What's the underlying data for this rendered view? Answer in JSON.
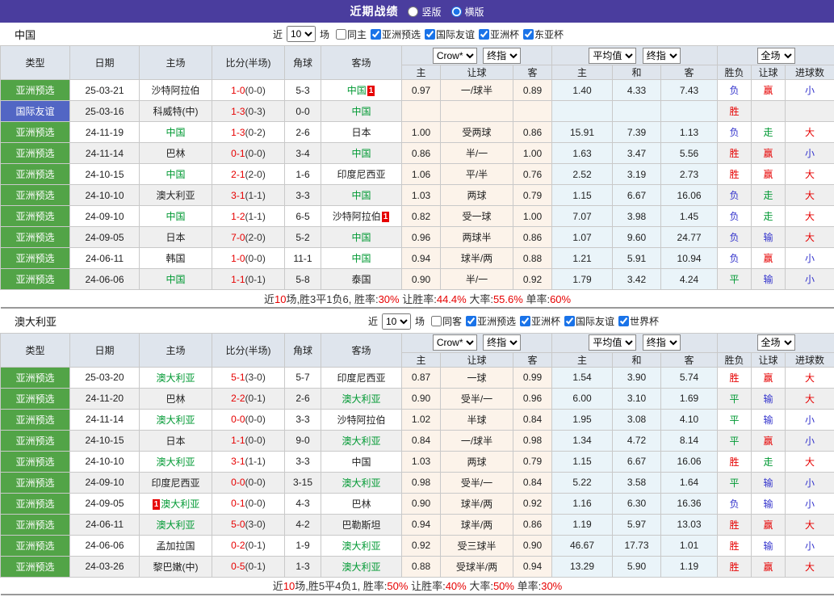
{
  "colors": {
    "purple_bar": "#4a3d9e",
    "type_green": "#52a447",
    "type_blue": "#5266c4",
    "focus_team_green": "#009933",
    "red": "#e60000",
    "green": "#009933",
    "blue": "#3333cc",
    "company_odds_bg": "#fcf3ea",
    "average_odds_bg": "#eaf4f9",
    "header_bg": "#dfe5ed",
    "row_alt_bg": "#efefef",
    "accent_blue": "#1a73e8"
  },
  "topbar": {
    "title": "近期战绩",
    "radios": [
      {
        "label": "竖版",
        "checked": false
      },
      {
        "label": "横版",
        "checked": true
      }
    ]
  },
  "columns": {
    "type": "类型",
    "date": "日期",
    "home": "主场",
    "score": "比分(半场)",
    "corner": "角球",
    "away": "客场",
    "odds_home": "主",
    "handicap": "让球",
    "odds_away": "客",
    "avg_home": "主",
    "avg_draw": "和",
    "avg_away": "客",
    "result": "胜负",
    "handicap_result": "让球",
    "goals": "进球数"
  },
  "selects": {
    "company": "Crow*",
    "company_mode": "终指",
    "average": "平均值",
    "average_mode": "终指",
    "scope": "全场"
  },
  "result_color_map": {
    "胜": "red",
    "平": "green",
    "负": "blue",
    "赢": "red",
    "走": "green",
    "输": "blue",
    "大": "red",
    "小": "blue"
  },
  "sections": [
    {
      "team": "中国",
      "filter": {
        "near_label": "近",
        "count": "10",
        "games_label": "场",
        "checkboxes": [
          {
            "label": "同主",
            "checked": false
          },
          {
            "label": "亚洲预选",
            "checked": true
          },
          {
            "label": "国际友谊",
            "checked": true
          },
          {
            "label": "亚洲杯",
            "checked": true
          },
          {
            "label": "东亚杯",
            "checked": true
          }
        ]
      },
      "rows": [
        {
          "type": "亚洲预选",
          "type_style": "green",
          "date": "25-03-21",
          "home": "沙特阿拉伯",
          "home_focus": false,
          "home_badge": "",
          "badge_before": false,
          "score_ft": "1-0",
          "score_ht": "0-0",
          "corner": "5-3",
          "away": "中国",
          "away_focus": true,
          "away_badge": "1",
          "odds": [
            "0.97",
            "一/球半",
            "0.89"
          ],
          "avg": [
            "1.40",
            "4.33",
            "7.43"
          ],
          "result": "负",
          "handicap_result": "赢",
          "goals": "小"
        },
        {
          "type": "国际友谊",
          "type_style": "blue",
          "date": "25-03-16",
          "home": "科威特(中)",
          "home_focus": false,
          "home_badge": "",
          "badge_before": false,
          "score_ft": "1-3",
          "score_ht": "0-3",
          "corner": "0-0",
          "away": "中国",
          "away_focus": true,
          "away_badge": "",
          "odds": [
            "",
            "",
            ""
          ],
          "avg": [
            "",
            "",
            ""
          ],
          "result": "胜",
          "handicap_result": "",
          "goals": ""
        },
        {
          "type": "亚洲预选",
          "type_style": "green",
          "date": "24-11-19",
          "home": "中国",
          "home_focus": true,
          "home_badge": "",
          "badge_before": false,
          "score_ft": "1-3",
          "score_ht": "0-2",
          "corner": "2-6",
          "away": "日本",
          "away_focus": false,
          "away_badge": "",
          "odds": [
            "1.00",
            "受两球",
            "0.86"
          ],
          "avg": [
            "15.91",
            "7.39",
            "1.13"
          ],
          "result": "负",
          "handicap_result": "走",
          "goals": "大"
        },
        {
          "type": "亚洲预选",
          "type_style": "green",
          "date": "24-11-14",
          "home": "巴林",
          "home_focus": false,
          "home_badge": "",
          "badge_before": false,
          "score_ft": "0-1",
          "score_ht": "0-0",
          "corner": "3-4",
          "away": "中国",
          "away_focus": true,
          "away_badge": "",
          "odds": [
            "0.86",
            "半/一",
            "1.00"
          ],
          "avg": [
            "1.63",
            "3.47",
            "5.56"
          ],
          "result": "胜",
          "handicap_result": "赢",
          "goals": "小"
        },
        {
          "type": "亚洲预选",
          "type_style": "green",
          "date": "24-10-15",
          "home": "中国",
          "home_focus": true,
          "home_badge": "",
          "badge_before": false,
          "score_ft": "2-1",
          "score_ht": "2-0",
          "corner": "1-6",
          "away": "印度尼西亚",
          "away_focus": false,
          "away_badge": "",
          "odds": [
            "1.06",
            "平/半",
            "0.76"
          ],
          "avg": [
            "2.52",
            "3.19",
            "2.73"
          ],
          "result": "胜",
          "handicap_result": "赢",
          "goals": "大"
        },
        {
          "type": "亚洲预选",
          "type_style": "green",
          "date": "24-10-10",
          "home": "澳大利亚",
          "home_focus": false,
          "home_badge": "",
          "badge_before": false,
          "score_ft": "3-1",
          "score_ht": "1-1",
          "corner": "3-3",
          "away": "中国",
          "away_focus": true,
          "away_badge": "",
          "odds": [
            "1.03",
            "两球",
            "0.79"
          ],
          "avg": [
            "1.15",
            "6.67",
            "16.06"
          ],
          "result": "负",
          "handicap_result": "走",
          "goals": "大"
        },
        {
          "type": "亚洲预选",
          "type_style": "green",
          "date": "24-09-10",
          "home": "中国",
          "home_focus": true,
          "home_badge": "",
          "badge_before": false,
          "score_ft": "1-2",
          "score_ht": "1-1",
          "corner": "6-5",
          "away": "沙特阿拉伯",
          "away_focus": false,
          "away_badge": "1",
          "odds": [
            "0.82",
            "受一球",
            "1.00"
          ],
          "avg": [
            "7.07",
            "3.98",
            "1.45"
          ],
          "result": "负",
          "handicap_result": "走",
          "goals": "大"
        },
        {
          "type": "亚洲预选",
          "type_style": "green",
          "date": "24-09-05",
          "home": "日本",
          "home_focus": false,
          "home_badge": "",
          "badge_before": false,
          "score_ft": "7-0",
          "score_ht": "2-0",
          "corner": "5-2",
          "away": "中国",
          "away_focus": true,
          "away_badge": "",
          "odds": [
            "0.96",
            "两球半",
            "0.86"
          ],
          "avg": [
            "1.07",
            "9.60",
            "24.77"
          ],
          "result": "负",
          "handicap_result": "输",
          "goals": "大"
        },
        {
          "type": "亚洲预选",
          "type_style": "green",
          "date": "24-06-11",
          "home": "韩国",
          "home_focus": false,
          "home_badge": "",
          "badge_before": false,
          "score_ft": "1-0",
          "score_ht": "0-0",
          "corner": "11-1",
          "away": "中国",
          "away_focus": true,
          "away_badge": "",
          "odds": [
            "0.94",
            "球半/两",
            "0.88"
          ],
          "avg": [
            "1.21",
            "5.91",
            "10.94"
          ],
          "result": "负",
          "handicap_result": "赢",
          "goals": "小"
        },
        {
          "type": "亚洲预选",
          "type_style": "green",
          "date": "24-06-06",
          "home": "中国",
          "home_focus": true,
          "home_badge": "",
          "badge_before": false,
          "score_ft": "1-1",
          "score_ht": "0-1",
          "corner": "5-8",
          "away": "泰国",
          "away_focus": false,
          "away_badge": "",
          "odds": [
            "0.90",
            "半/一",
            "0.92"
          ],
          "avg": [
            "1.79",
            "3.42",
            "4.24"
          ],
          "result": "平",
          "handicap_result": "输",
          "goals": "小"
        }
      ],
      "summary": [
        [
          "近",
          false
        ],
        [
          "10",
          true
        ],
        [
          "场,胜3平1负6, 胜率:",
          false
        ],
        [
          "30%",
          true
        ],
        [
          " 让胜率:",
          false
        ],
        [
          "44.4%",
          true
        ],
        [
          " 大率:",
          false
        ],
        [
          "55.6%",
          true
        ],
        [
          " 单率:",
          false
        ],
        [
          "60%",
          true
        ]
      ]
    },
    {
      "team": "澳大利亚",
      "filter": {
        "near_label": "近",
        "count": "10",
        "games_label": "场",
        "checkboxes": [
          {
            "label": "同客",
            "checked": false
          },
          {
            "label": "亚洲预选",
            "checked": true
          },
          {
            "label": "亚洲杯",
            "checked": true
          },
          {
            "label": "国际友谊",
            "checked": true
          },
          {
            "label": "世界杯",
            "checked": true
          }
        ]
      },
      "rows": [
        {
          "type": "亚洲预选",
          "type_style": "green",
          "date": "25-03-20",
          "home": "澳大利亚",
          "home_focus": true,
          "home_badge": "",
          "badge_before": false,
          "score_ft": "5-1",
          "score_ht": "3-0",
          "corner": "5-7",
          "away": "印度尼西亚",
          "away_focus": false,
          "away_badge": "",
          "odds": [
            "0.87",
            "一球",
            "0.99"
          ],
          "avg": [
            "1.54",
            "3.90",
            "5.74"
          ],
          "result": "胜",
          "handicap_result": "赢",
          "goals": "大"
        },
        {
          "type": "亚洲预选",
          "type_style": "green",
          "date": "24-11-20",
          "home": "巴林",
          "home_focus": false,
          "home_badge": "",
          "badge_before": false,
          "score_ft": "2-2",
          "score_ht": "0-1",
          "corner": "2-6",
          "away": "澳大利亚",
          "away_focus": true,
          "away_badge": "",
          "odds": [
            "0.90",
            "受半/一",
            "0.96"
          ],
          "avg": [
            "6.00",
            "3.10",
            "1.69"
          ],
          "result": "平",
          "handicap_result": "输",
          "goals": "大"
        },
        {
          "type": "亚洲预选",
          "type_style": "green",
          "date": "24-11-14",
          "home": "澳大利亚",
          "home_focus": true,
          "home_badge": "",
          "badge_before": false,
          "score_ft": "0-0",
          "score_ht": "0-0",
          "corner": "3-3",
          "away": "沙特阿拉伯",
          "away_focus": false,
          "away_badge": "",
          "odds": [
            "1.02",
            "半球",
            "0.84"
          ],
          "avg": [
            "1.95",
            "3.08",
            "4.10"
          ],
          "result": "平",
          "handicap_result": "输",
          "goals": "小"
        },
        {
          "type": "亚洲预选",
          "type_style": "green",
          "date": "24-10-15",
          "home": "日本",
          "home_focus": false,
          "home_badge": "",
          "badge_before": false,
          "score_ft": "1-1",
          "score_ht": "0-0",
          "corner": "9-0",
          "away": "澳大利亚",
          "away_focus": true,
          "away_badge": "",
          "odds": [
            "0.84",
            "一/球半",
            "0.98"
          ],
          "avg": [
            "1.34",
            "4.72",
            "8.14"
          ],
          "result": "平",
          "handicap_result": "赢",
          "goals": "小"
        },
        {
          "type": "亚洲预选",
          "type_style": "green",
          "date": "24-10-10",
          "home": "澳大利亚",
          "home_focus": true,
          "home_badge": "",
          "badge_before": false,
          "score_ft": "3-1",
          "score_ht": "1-1",
          "corner": "3-3",
          "away": "中国",
          "away_focus": false,
          "away_badge": "",
          "odds": [
            "1.03",
            "两球",
            "0.79"
          ],
          "avg": [
            "1.15",
            "6.67",
            "16.06"
          ],
          "result": "胜",
          "handicap_result": "走",
          "goals": "大"
        },
        {
          "type": "亚洲预选",
          "type_style": "green",
          "date": "24-09-10",
          "home": "印度尼西亚",
          "home_focus": false,
          "home_badge": "",
          "badge_before": false,
          "score_ft": "0-0",
          "score_ht": "0-0",
          "corner": "3-15",
          "away": "澳大利亚",
          "away_focus": true,
          "away_badge": "",
          "odds": [
            "0.98",
            "受半/一",
            "0.84"
          ],
          "avg": [
            "5.22",
            "3.58",
            "1.64"
          ],
          "result": "平",
          "handicap_result": "输",
          "goals": "小"
        },
        {
          "type": "亚洲预选",
          "type_style": "green",
          "date": "24-09-05",
          "home": "澳大利亚",
          "home_focus": true,
          "home_badge": "1",
          "badge_before": true,
          "score_ft": "0-1",
          "score_ht": "0-0",
          "corner": "4-3",
          "away": "巴林",
          "away_focus": false,
          "away_badge": "",
          "odds": [
            "0.90",
            "球半/两",
            "0.92"
          ],
          "avg": [
            "1.16",
            "6.30",
            "16.36"
          ],
          "result": "负",
          "handicap_result": "输",
          "goals": "小"
        },
        {
          "type": "亚洲预选",
          "type_style": "green",
          "date": "24-06-11",
          "home": "澳大利亚",
          "home_focus": true,
          "home_badge": "",
          "badge_before": false,
          "score_ft": "5-0",
          "score_ht": "3-0",
          "corner": "4-2",
          "away": "巴勒斯坦",
          "away_focus": false,
          "away_badge": "",
          "odds": [
            "0.94",
            "球半/两",
            "0.86"
          ],
          "avg": [
            "1.19",
            "5.97",
            "13.03"
          ],
          "result": "胜",
          "handicap_result": "赢",
          "goals": "大"
        },
        {
          "type": "亚洲预选",
          "type_style": "green",
          "date": "24-06-06",
          "home": "孟加拉国",
          "home_focus": false,
          "home_badge": "",
          "badge_before": false,
          "score_ft": "0-2",
          "score_ht": "0-1",
          "corner": "1-9",
          "away": "澳大利亚",
          "away_focus": true,
          "away_badge": "",
          "odds": [
            "0.92",
            "受三球半",
            "0.90"
          ],
          "avg": [
            "46.67",
            "17.73",
            "1.01"
          ],
          "result": "胜",
          "handicap_result": "输",
          "goals": "小"
        },
        {
          "type": "亚洲预选",
          "type_style": "green",
          "date": "24-03-26",
          "home": "黎巴嫩(中)",
          "home_focus": false,
          "home_badge": "",
          "badge_before": false,
          "score_ft": "0-5",
          "score_ht": "0-1",
          "corner": "1-3",
          "away": "澳大利亚",
          "away_focus": true,
          "away_badge": "",
          "odds": [
            "0.88",
            "受球半/两",
            "0.94"
          ],
          "avg": [
            "13.29",
            "5.90",
            "1.19"
          ],
          "result": "胜",
          "handicap_result": "赢",
          "goals": "大"
        }
      ],
      "summary": [
        [
          "近",
          false
        ],
        [
          "10",
          true
        ],
        [
          "场,胜5平4负1, 胜率:",
          false
        ],
        [
          "50%",
          true
        ],
        [
          " 让胜率:",
          false
        ],
        [
          "40%",
          true
        ],
        [
          " 大率:",
          false
        ],
        [
          "50%",
          true
        ],
        [
          " 单率:",
          false
        ],
        [
          "30%",
          true
        ]
      ]
    }
  ]
}
